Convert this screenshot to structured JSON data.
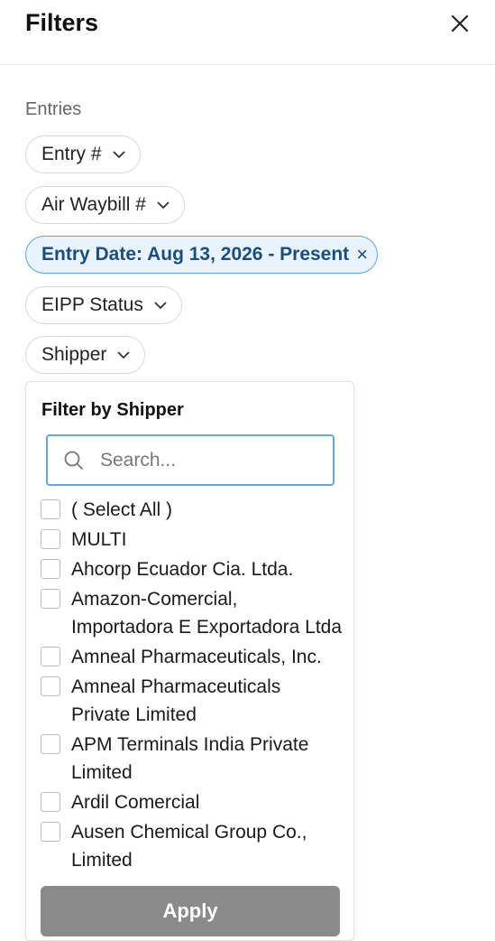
{
  "header": {
    "title": "Filters",
    "close_icon": "close-icon"
  },
  "section": {
    "label": "Entries"
  },
  "filters": {
    "entry_number": "Entry #",
    "air_waybill": "Air Waybill #",
    "entry_date": "Entry Date: Aug 13, 2026 - Present",
    "entry_date_remove": "×",
    "eipp_status": "EIPP Status",
    "shipper": "Shipper"
  },
  "dropdown": {
    "title": "Filter by Shipper",
    "search_placeholder": "Search...",
    "search_icon": "search-icon",
    "items": [
      "( Select All )",
      "MULTI",
      "Ahcorp Ecuador Cia. Ltda.",
      "Amazon-Comercial, Importadora E Exportadora Ltda",
      "Amneal Pharmaceuticals, Inc.",
      "Amneal Pharmaceuticals Private Limited",
      "APM Terminals India Private Limited",
      "Ardil Comercial",
      "Ausen Chemical Group Co., Limited"
    ],
    "apply_label": "Apply"
  },
  "colors": {
    "accent": "#5aa7d8",
    "active_bg": "#e8f3fb",
    "apply_bg": "#8a8a8a"
  }
}
